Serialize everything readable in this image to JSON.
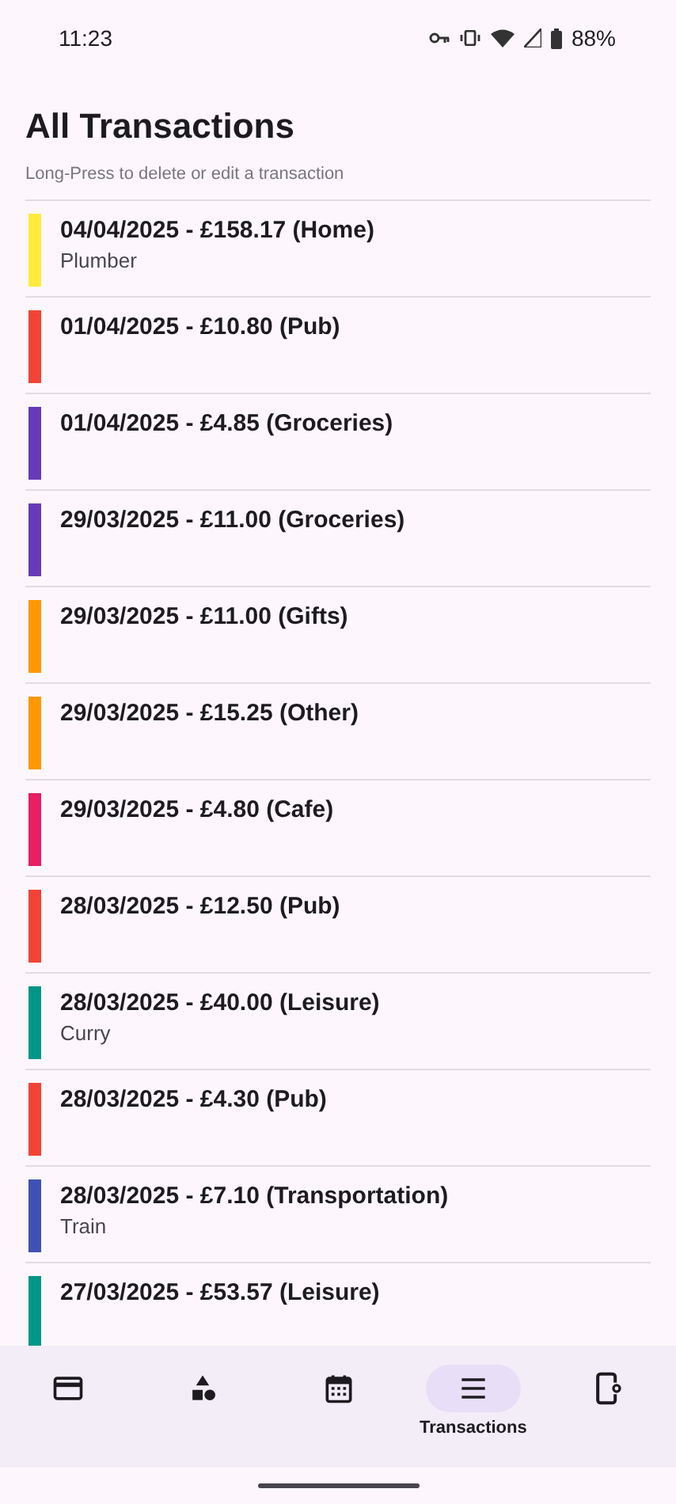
{
  "status_bar": {
    "time": "11:23",
    "battery": "88%"
  },
  "header": {
    "title": "All Transactions",
    "subtitle": "Long-Press to delete or edit a transaction"
  },
  "transactions": [
    {
      "title": "04/04/2025 - £158.17 (Home)",
      "note": "Plumber",
      "color": "#ffeb3b"
    },
    {
      "title": "01/04/2025 - £10.80 (Pub)",
      "color": "#f44336"
    },
    {
      "title": "01/04/2025 - £4.85 (Groceries)",
      "color": "#673ab7"
    },
    {
      "title": "29/03/2025 - £11.00 (Groceries)",
      "color": "#673ab7"
    },
    {
      "title": "29/03/2025 - £11.00 (Gifts)",
      "color": "#ff9800"
    },
    {
      "title": "29/03/2025 - £15.25 (Other)",
      "color": "#ff9800"
    },
    {
      "title": "29/03/2025 - £4.80 (Cafe)",
      "color": "#e91e63"
    },
    {
      "title": "28/03/2025 - £12.50 (Pub)",
      "color": "#f44336"
    },
    {
      "title": "28/03/2025 - £40.00 (Leisure)",
      "note": "Curry",
      "color": "#009688"
    },
    {
      "title": "28/03/2025 - £4.30 (Pub)",
      "color": "#f44336"
    },
    {
      "title": "28/03/2025 - £7.10 (Transportation)",
      "note": "Train",
      "color": "#3f51b5"
    },
    {
      "title": "27/03/2025 - £53.57 (Leisure)",
      "color": "#009688"
    }
  ],
  "nav": [
    {
      "kind": "card",
      "selected": false
    },
    {
      "kind": "shapes",
      "selected": false
    },
    {
      "kind": "calendar",
      "selected": false
    },
    {
      "kind": "list",
      "selected": true,
      "label": "Transactions"
    },
    {
      "kind": "device",
      "selected": false
    }
  ]
}
